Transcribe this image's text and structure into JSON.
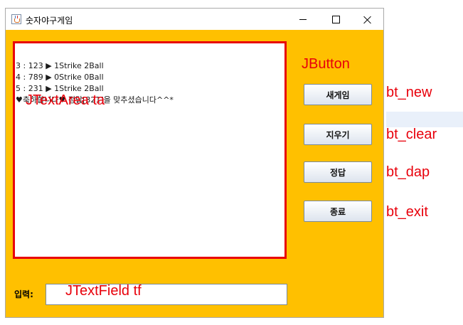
{
  "window": {
    "title": "숫자야구게임",
    "controls": {
      "minimize": "minimize-icon",
      "maximize": "maximize-icon",
      "close": "close-icon"
    }
  },
  "textarea": {
    "lines": [
      "3 : 123 ▶ 1Strike 2Ball",
      "4 : 789 ▶ 0Strike 0Ball",
      "5 : 231 ▶ 1Strike 2Ball",
      "♥축하합니다♥ 정답[321]을 맞추셨습니다^^*"
    ],
    "annotation": "JTextArea ta"
  },
  "buttons": {
    "annotation": "JButton",
    "new_label": "새게임",
    "clear_label": "지우기",
    "dap_label": "정답",
    "exit_label": "종료"
  },
  "input": {
    "label": "입력:",
    "annotation": "JTextField tf",
    "value": ""
  },
  "annotations_outside": {
    "new": "bt_new",
    "clear": "bt_clear",
    "dap": "bt_dap",
    "exit": "bt_exit"
  },
  "colors": {
    "window_bg": "#ffc000",
    "annotation": "#e8000b",
    "textarea_border": "#e8000b"
  }
}
